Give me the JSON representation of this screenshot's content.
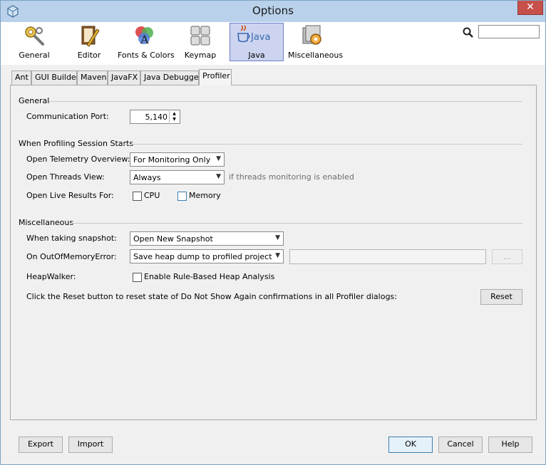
{
  "window": {
    "title": "Options"
  },
  "categories": [
    {
      "label": "General",
      "icon": "gear-wrench-icon"
    },
    {
      "label": "Editor",
      "icon": "editor-icon"
    },
    {
      "label": "Fonts & Colors",
      "icon": "fonts-colors-icon"
    },
    {
      "label": "Keymap",
      "icon": "keymap-icon"
    },
    {
      "label": "Java",
      "icon": "java-icon",
      "selected": true
    },
    {
      "label": "Miscellaneous",
      "icon": "miscellaneous-icon"
    }
  ],
  "search": {
    "value": ""
  },
  "tabs": [
    {
      "label": "Ant"
    },
    {
      "label": "GUI Builder"
    },
    {
      "label": "Maven"
    },
    {
      "label": "JavaFX"
    },
    {
      "label": "Java Debugger"
    },
    {
      "label": "Profiler",
      "active": true
    }
  ],
  "general": {
    "title": "General",
    "comm_port_label": "Communication Port:",
    "comm_port_value": "5,140"
  },
  "session": {
    "title": "When Profiling Session Starts",
    "telemetry_label": "Open Telemetry Overview:",
    "telemetry_value": "For Monitoring Only",
    "threads_label": "Open Threads View:",
    "threads_value": "Always",
    "threads_hint": "if threads monitoring is enabled",
    "live_label": "Open Live Results For:",
    "cpu_label": "CPU",
    "memory_label": "Memory"
  },
  "misc": {
    "title": "Miscellaneous",
    "snapshot_label": "When taking snapshot:",
    "snapshot_value": "Open New Snapshot",
    "oom_label": "On OutOfMemoryError:",
    "oom_value": "Save heap dump to profiled project",
    "browse_label": "...",
    "heapwalker_label": "HeapWalker:",
    "heapwalker_check": "Enable Rule-Based Heap Analysis",
    "reset_text": "Click the Reset button to reset state of Do Not Show Again confirmations in all Profiler dialogs:",
    "reset_button": "Reset"
  },
  "footer": {
    "export": "Export",
    "import": "Import",
    "ok": "OK",
    "cancel": "Cancel",
    "help": "Help"
  },
  "colors": {
    "titlebar": "#b9d1ea",
    "selected_category": "#ccd4ef",
    "close_button": "#c7504a"
  }
}
